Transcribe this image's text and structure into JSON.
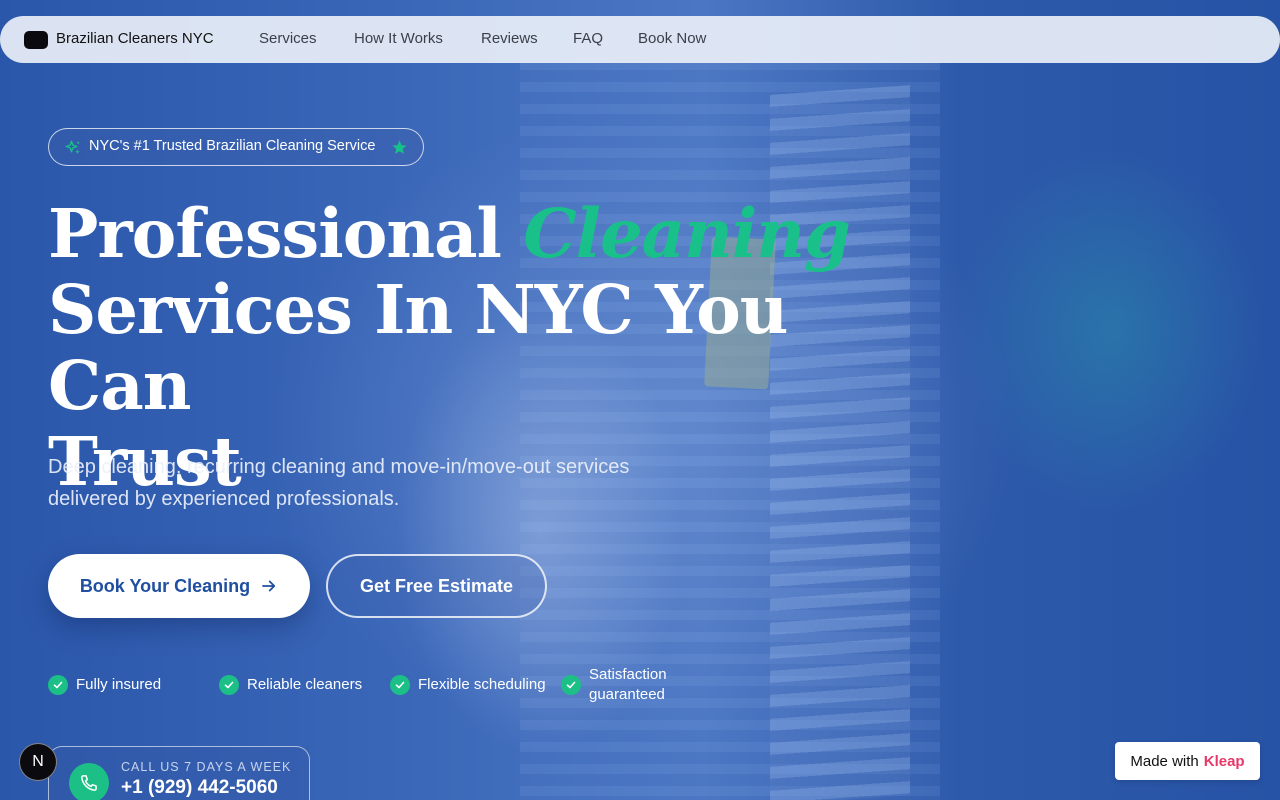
{
  "nav": {
    "brand": "Brazilian Cleaners NYC",
    "links": [
      "Services",
      "How It Works",
      "Reviews",
      "FAQ",
      "Book Now"
    ]
  },
  "badge": {
    "text": "NYC's #1 Trusted Brazilian Cleaning Service"
  },
  "hero": {
    "headline_pre": "Professional ",
    "headline_accent": "Cleaning",
    "headline_line2": "Services In NYC You Can",
    "headline_line3": "Trust",
    "subtitle": "Deep cleaning, recurring cleaning and move-in/move-out services delivered by experienced professionals."
  },
  "buttons": {
    "primary": "Book Your Cleaning",
    "secondary": "Get Free Estimate"
  },
  "features": [
    {
      "label": "Fully insured"
    },
    {
      "label": "Reliable cleaners"
    },
    {
      "label": "Flexible scheduling"
    },
    {
      "label": "Satisfaction guaranteed"
    }
  ],
  "call": {
    "label": "CALL US 7 DAYS A WEEK",
    "number": "+1 (929) 442-5060"
  },
  "widgets": {
    "n_label": "N",
    "made_with": "Made with",
    "made_brand": "Kleap"
  },
  "colors": {
    "accent_green": "#19c08a",
    "hero_blue": "#2a55a8",
    "primary_text_blue": "#1f4fa0",
    "kleap_pink": "#e8386a"
  },
  "icons": [
    "logo-mark-icon",
    "sparkle-icon",
    "star-icon",
    "arrow-right-icon",
    "check-icon",
    "phone-icon"
  ]
}
